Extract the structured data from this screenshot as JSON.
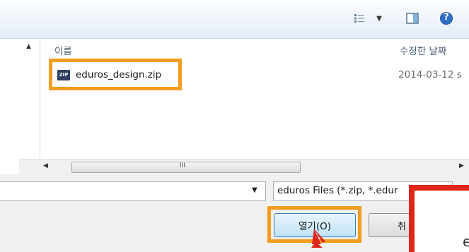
{
  "toolbar": {
    "view_icon": "view-list-icon",
    "dropdown_arrow": "▼",
    "pane_icon": "preview-pane-icon",
    "help_icon": "help-icon",
    "help_glyph": "?"
  },
  "file_list": {
    "columns": [
      {
        "label": "이름"
      },
      {
        "label": "수정한 날짜"
      }
    ],
    "files": [
      {
        "name": "eduros_design.zip",
        "icon_text": "ZIP",
        "modified": "2014-03-12 s"
      }
    ]
  },
  "scroll": {
    "up_arrow": "▲",
    "down_arrow": "▼",
    "left_arrow": "◀",
    "right_arrow": "▶",
    "grip": "III"
  },
  "bottom": {
    "filename_value": "",
    "filename_dropdown_arrow": "▼",
    "filter_value": "eduros Files (*.zip, *.edur",
    "open_label": "열기(O)",
    "cancel_label": "취",
    "overlay_text": "e"
  },
  "colors": {
    "highlight_orange": "#f39c1e",
    "highlight_red": "#e0251b"
  }
}
